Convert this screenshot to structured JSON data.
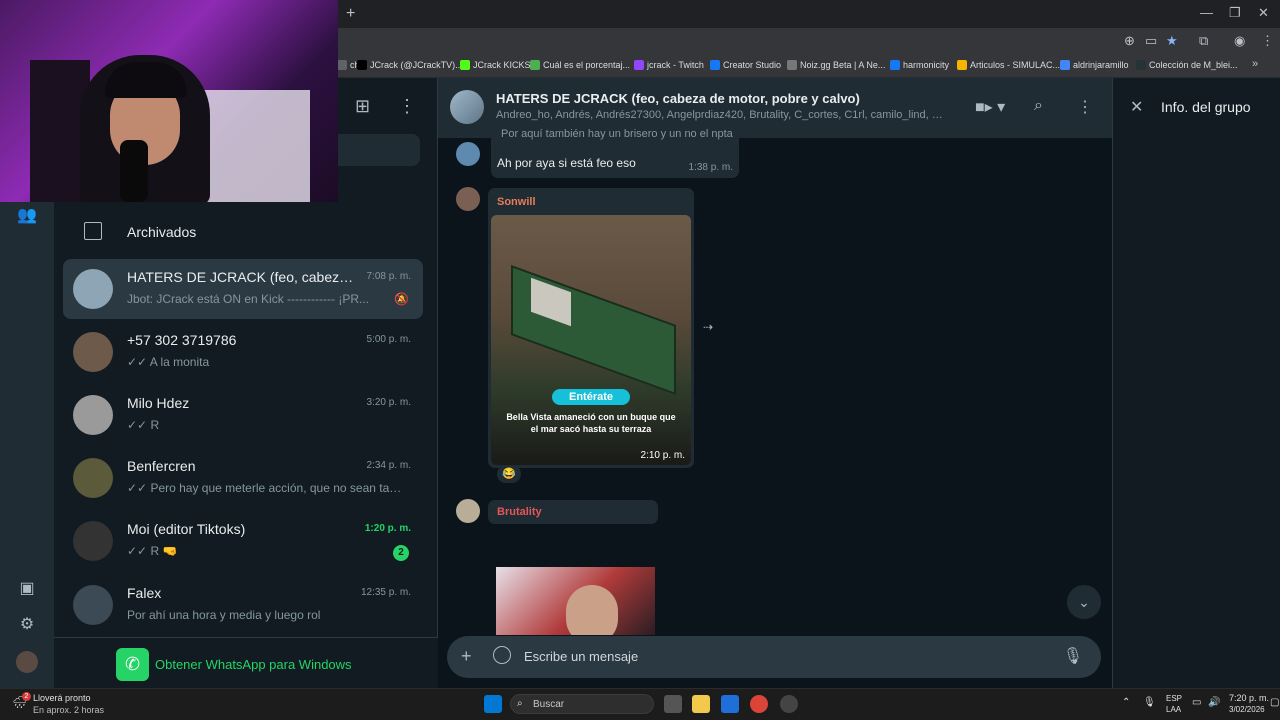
{
  "browser": {
    "bookmarks": [
      {
        "label": "ch",
        "color": "#5f6368"
      },
      {
        "label": "JCrack (@JCrackTV)...",
        "color": "#000000"
      },
      {
        "label": "JCrack KICKS",
        "color": "#53fc18"
      },
      {
        "label": "Cuál es el porcentaj...",
        "color": "#4caf50"
      },
      {
        "label": "jcrack - Twitch",
        "color": "#9146ff"
      },
      {
        "label": "Creator Studio",
        "color": "#1877f2"
      },
      {
        "label": "Noiz.gg Beta | A Ne...",
        "color": "#777777"
      },
      {
        "label": "harmonicity",
        "color": "#1877f2"
      },
      {
        "label": "Articulos - SIMULAC...",
        "color": "#f4b400"
      },
      {
        "label": "aldrinjaramillo",
        "color": "#4285f4"
      },
      {
        "label": "Colección de M_blei...",
        "color": "#263238"
      }
    ]
  },
  "sidebar": {
    "archived_label": "Archivados",
    "get_app_label": "Obtener WhatsApp para Windows"
  },
  "chats": [
    {
      "name": "HATERS DE JCRACK (feo, cabeza de ...",
      "time": "7:08 p. m.",
      "preview": "Jbot: JCrack está ON en Kick  ------------  ¡PR...",
      "muted": true,
      "avatar_color": "#8ea5b6"
    },
    {
      "name": "+57 302 3719786",
      "time": "5:00 p. m.",
      "preview": "✓✓ A la monita",
      "avatar_color": "#6e5a4a"
    },
    {
      "name": "Milo Hdez",
      "time": "3:20 p. m.",
      "preview": "✓✓ R",
      "avatar_color": "#9a9a9a"
    },
    {
      "name": "Benfercren",
      "time": "2:34 p. m.",
      "preview": "✓✓ Pero hay que meterle acción, que no sean tan grav...",
      "avatar_color": "#5b5a3a"
    },
    {
      "name": "Moi (editor Tiktoks)",
      "time": "1:20 p. m.",
      "preview": "✓✓ R 🤜",
      "unread": "2",
      "avatar_color": "#333333"
    },
    {
      "name": "Falex",
      "time": "12:35 p. m.",
      "preview": "Por ahí una hora y media y luego rol",
      "avatar_color": "#3b4a54"
    }
  ],
  "conversation": {
    "title": "HATERS DE JCRACK (feo, cabeza de motor, pobre y calvo)",
    "members": "Andreo_ho, Andrés, Andrés27300, Angelprdiaz420, Brutality, C_cortes, C1rl, camilo_lind, CAR...",
    "message1_cut": "Por aquí también hay un brisero y un no el npta",
    "message1": "Ah por aya si está feo eso",
    "message1_time": "1:38 p. m.",
    "sender2": "Sonwill",
    "sender2_color": "#e67e5a",
    "image_badge": "Entérate",
    "image_caption": "Bella Vista amaneció con un buque que el mar sacó hasta su terraza",
    "image_time": "2:10 p. m.",
    "reaction": "😂",
    "sender3": "Brutality",
    "sender3_color": "#e5565a",
    "composer_placeholder": "Escribe un mensaje"
  },
  "info_pane": {
    "title": "Info. del grupo"
  },
  "taskbar": {
    "weather_line1": "Lloverá pronto",
    "weather_line2": "En aprox. 2 horas",
    "weather_badge": "2",
    "search_label": "Buscar",
    "lang_line1": "ESP",
    "lang_line2": "LAA",
    "clock_time": "7:20 p. m.",
    "clock_date": "3/02/2026"
  },
  "colors": {
    "accent": "#25d366",
    "background": "#111b21",
    "panel": "#202c33"
  }
}
